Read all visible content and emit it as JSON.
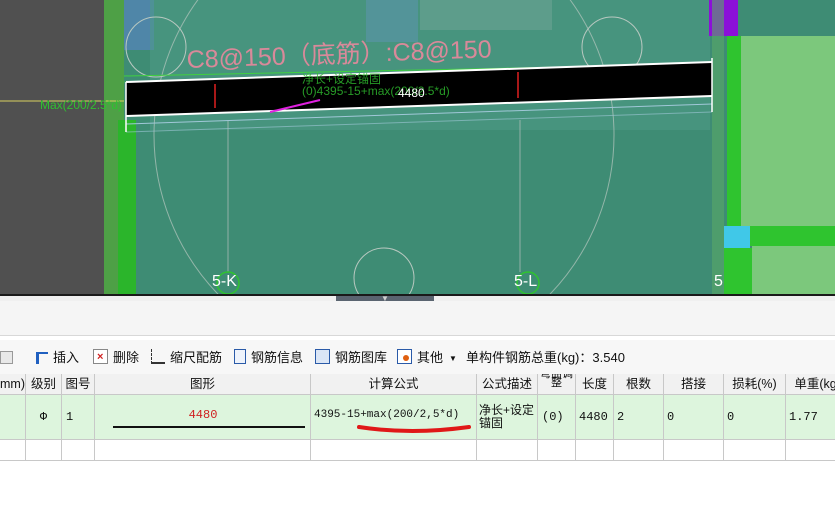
{
  "canvas": {
    "rebar_label": "C8@150（底筋）:C8@150",
    "bar_length": "4480",
    "overlay_label_1": "净长+设定锚固",
    "overlay_label_2": "(0)4395-15+max(200/2.5*d)",
    "left_anchor_text": "Max(200/2.5*d)",
    "axis_labels": [
      "5-K",
      "5-L",
      "5"
    ],
    "colors": {
      "background": "#3e8c74",
      "rebar_label": "#d9899a",
      "bar": "#000000",
      "axis_text": "#ffffff",
      "green_beam": "#2fc42f",
      "purple_block": "#8b10d8",
      "cyan_block": "#40c8e8"
    }
  },
  "toolbar": {
    "insert": "插入",
    "delete": "删除",
    "scale_config": "缩尺配筋",
    "rebar_info": "钢筋信息",
    "rebar_library": "钢筋图库",
    "other": "其他",
    "total_weight": "单构件钢筋总重(kg)：3.540"
  },
  "table": {
    "headers": [
      "mm)",
      "级别",
      "图号",
      "图形",
      "计算公式",
      "公式描述",
      "弯曲调整",
      "长度",
      "根数",
      "搭接",
      "损耗(%)",
      "单重(kg"
    ],
    "row": {
      "grade_symbol": "Φ",
      "figure_no": "1",
      "shape_length": "4480",
      "formula": "4395-15+max(200/2,5*d)",
      "description": "净长+设定锚固",
      "bend_adjust": "(0)",
      "length": "4480",
      "count": "2",
      "lap": "0",
      "loss": "0",
      "unit_weight": "1.77"
    }
  }
}
